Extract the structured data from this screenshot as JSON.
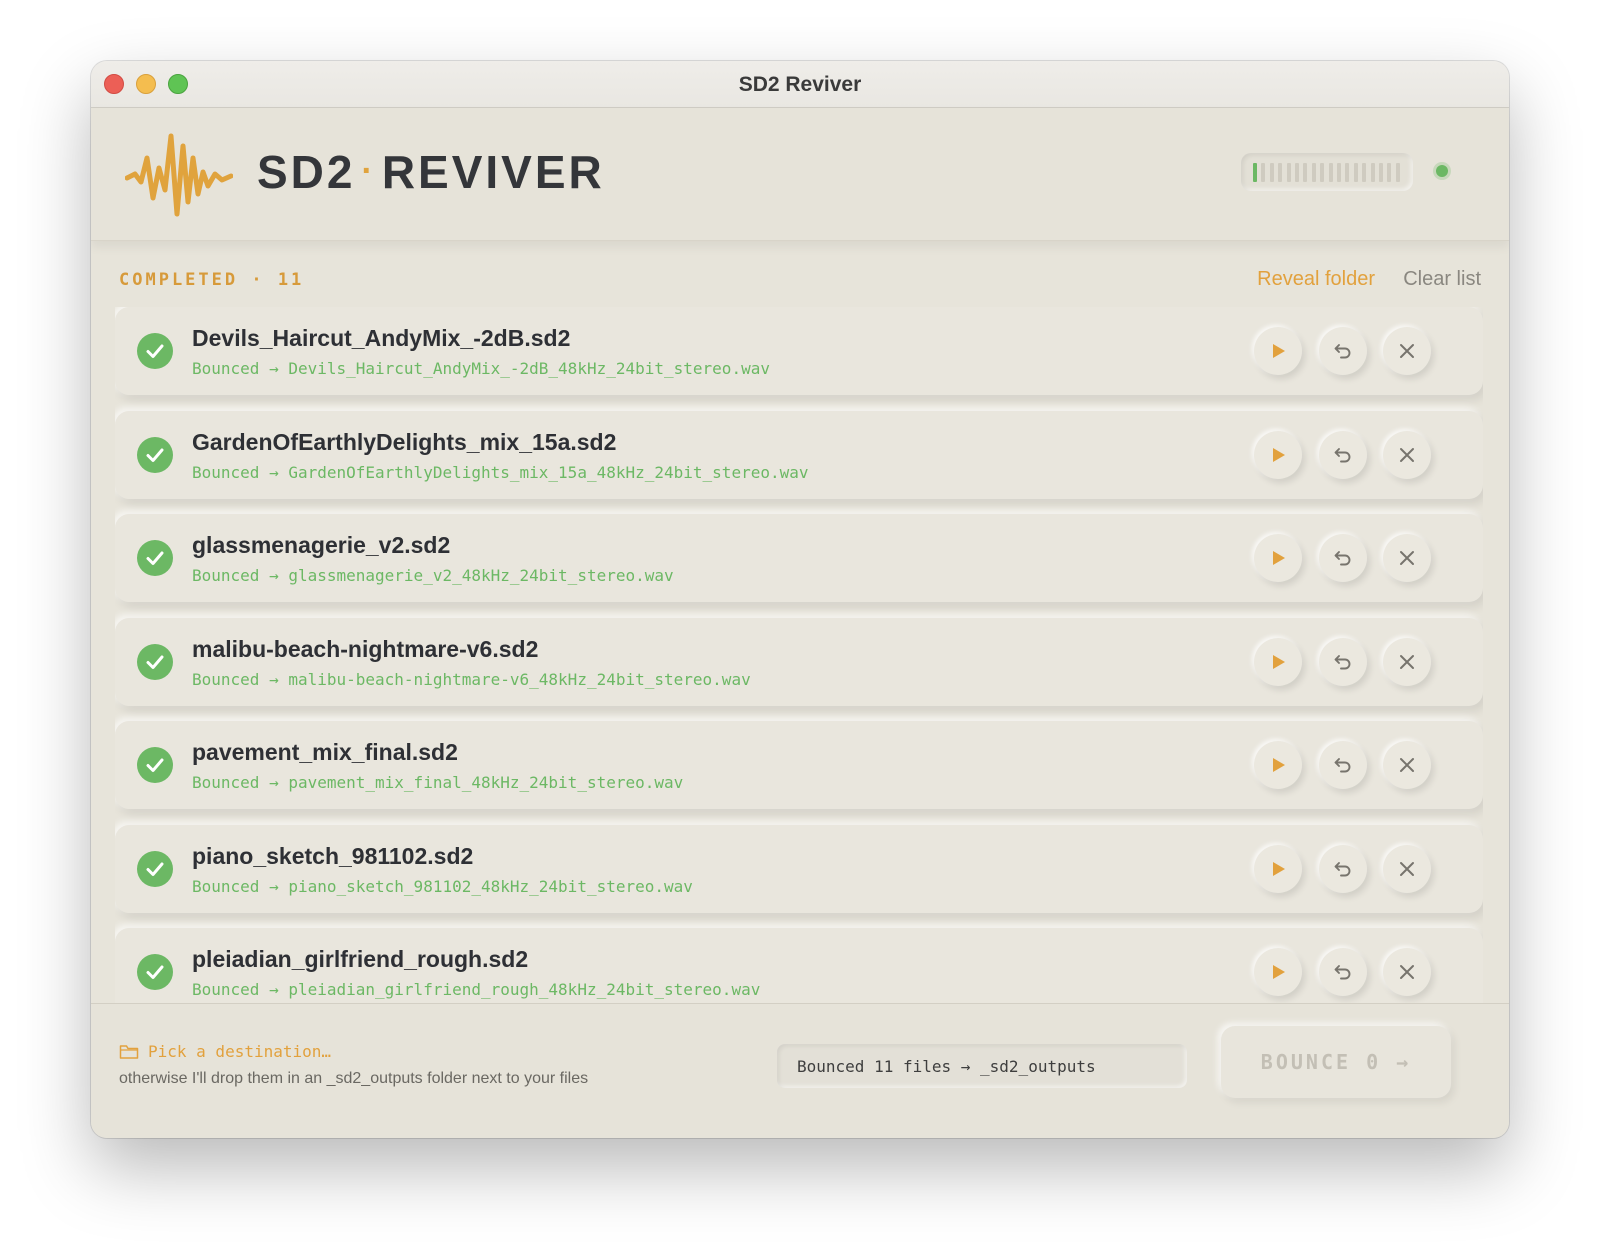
{
  "window": {
    "title": "SD2 Reviver"
  },
  "header": {
    "brand_left": "SD2",
    "brand_separator": "·",
    "brand_right": "REVIVER",
    "level_meter": 0.05,
    "status_color": "#6cb864"
  },
  "colors": {
    "accent": "#e2a13d",
    "success": "#6cb864",
    "background": "#e7e4da"
  },
  "section": {
    "label": "COMPLETED · 11",
    "reveal_label": "Reveal folder",
    "clear_label": "Clear list"
  },
  "items": [
    {
      "name": "Devils_Haircut_AndyMix_-2dB.sd2",
      "output": "Bounced → Devils_Haircut_AndyMix_-2dB_48kHz_24bit_stereo.wav"
    },
    {
      "name": "GardenOfEarthlyDelights_mix_15a.sd2",
      "output": "Bounced → GardenOfEarthlyDelights_mix_15a_48kHz_24bit_stereo.wav"
    },
    {
      "name": "glassmenagerie_v2.sd2",
      "output": "Bounced → glassmenagerie_v2_48kHz_24bit_stereo.wav"
    },
    {
      "name": "malibu-beach-nightmare-v6.sd2",
      "output": "Bounced → malibu-beach-nightmare-v6_48kHz_24bit_stereo.wav"
    },
    {
      "name": "pavement_mix_final.sd2",
      "output": "Bounced → pavement_mix_final_48kHz_24bit_stereo.wav"
    },
    {
      "name": "piano_sketch_981102.sd2",
      "output": "Bounced → piano_sketch_981102_48kHz_24bit_stereo.wav"
    },
    {
      "name": "pleiadian_girlfriend_rough.sd2",
      "output": "Bounced → pleiadian_girlfriend_rough_48kHz_24bit_stereo.wav"
    }
  ],
  "icons": {
    "status": "check-circle-icon",
    "play": "play-icon",
    "undo": "undo-icon",
    "remove": "close-icon",
    "folder": "folder-icon"
  },
  "footer": {
    "destination_label": "Pick a destination…",
    "destination_note": "otherwise I'll drop them in an _sd2_outputs folder next to your files",
    "status_text": "Bounced 11 files → _sd2_outputs",
    "bounce_label": "BOUNCE 0 →"
  }
}
